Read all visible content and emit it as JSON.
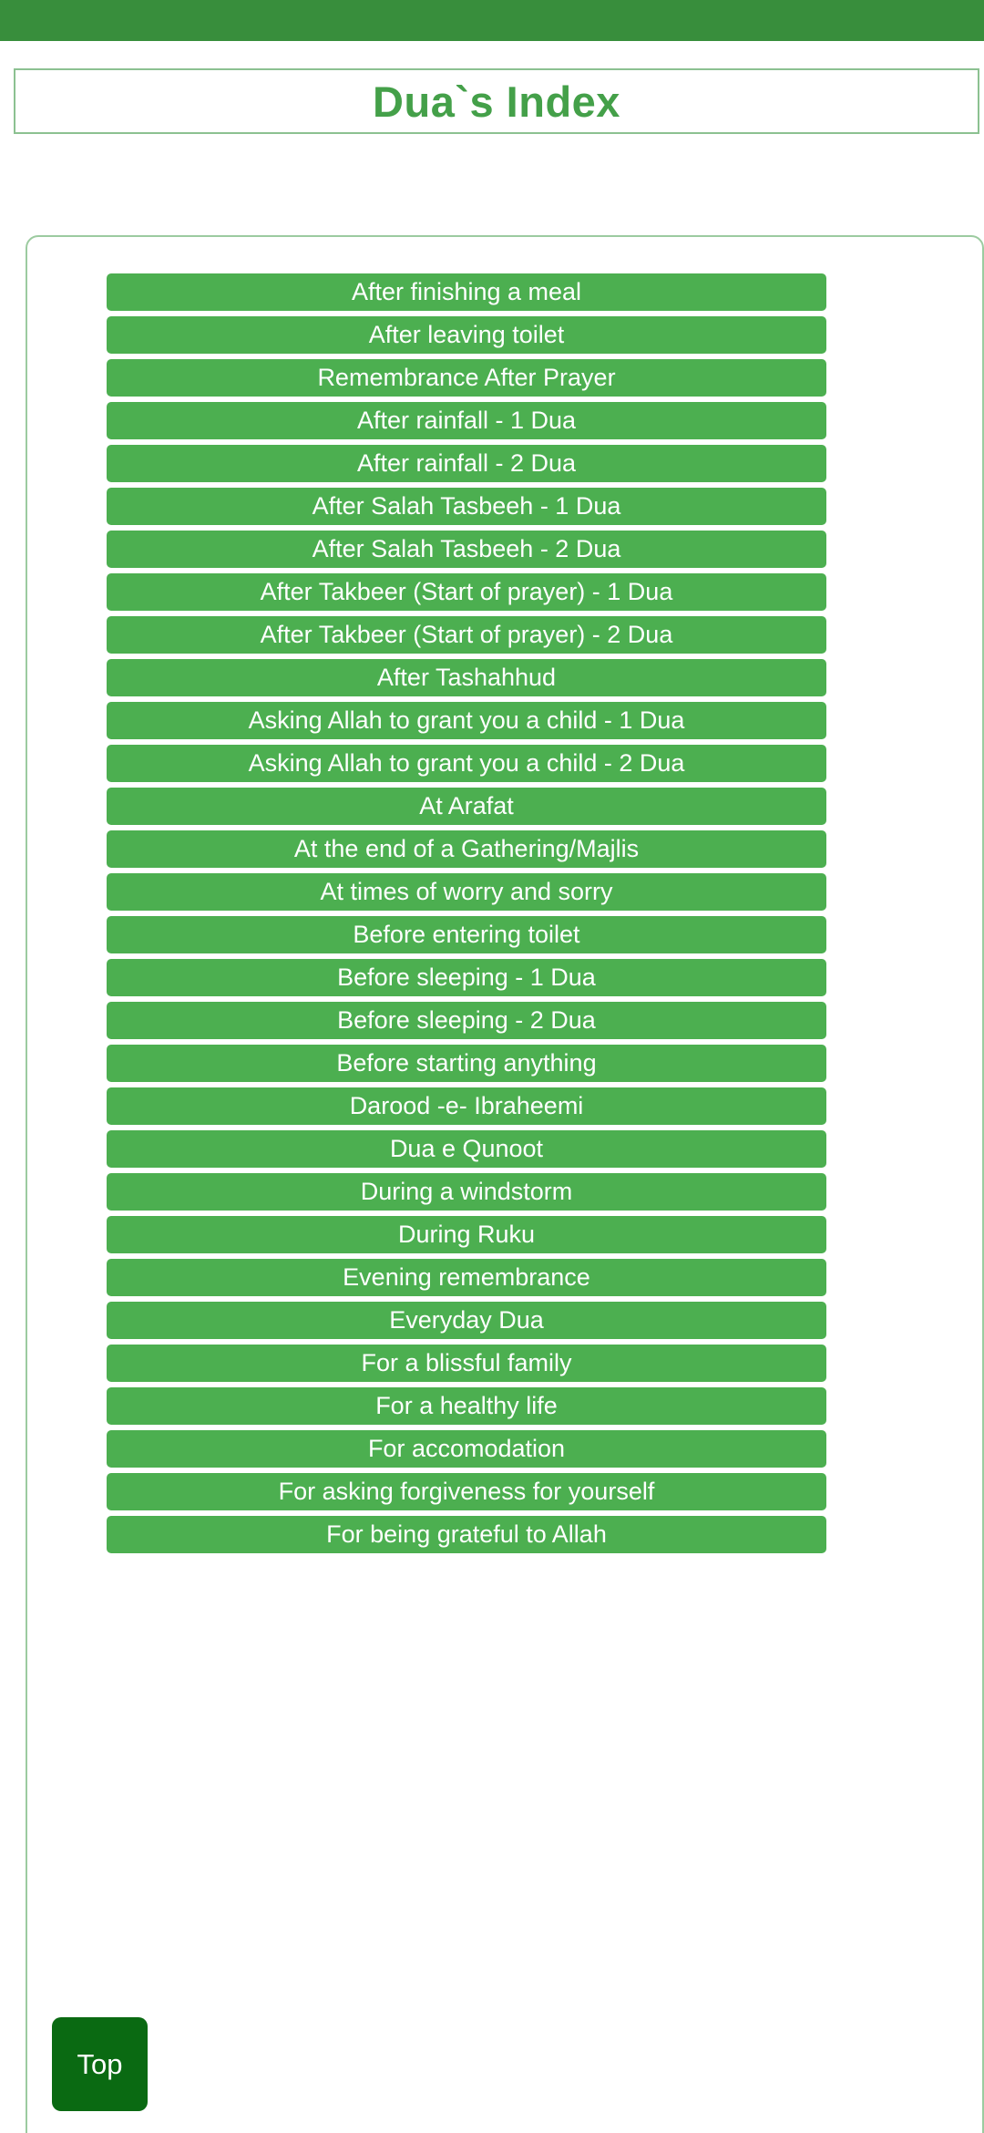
{
  "app": {
    "topbar_color": "#388e3c",
    "accent_color": "#4caf50",
    "title_color": "#44a049",
    "fab_color": "#0a6a12"
  },
  "header": {
    "title": "Dua`s Index"
  },
  "fab": {
    "label": "Top",
    "name": "scroll-to-top-button"
  },
  "list": {
    "items": [
      {
        "label": "After finishing a meal"
      },
      {
        "label": "After leaving toilet"
      },
      {
        "label": "Remembrance After Prayer"
      },
      {
        "label": "After rainfall - 1 Dua"
      },
      {
        "label": "After rainfall - 2 Dua"
      },
      {
        "label": "After Salah Tasbeeh - 1 Dua"
      },
      {
        "label": "After Salah Tasbeeh - 2 Dua"
      },
      {
        "label": "After Takbeer (Start of prayer) - 1 Dua"
      },
      {
        "label": "After Takbeer (Start of prayer) - 2 Dua"
      },
      {
        "label": "After Tashahhud"
      },
      {
        "label": "Asking Allah to grant you a child - 1 Dua"
      },
      {
        "label": "Asking Allah to grant you a child - 2 Dua"
      },
      {
        "label": "At Arafat"
      },
      {
        "label": "At the end of a Gathering/Majlis"
      },
      {
        "label": "At times of worry and sorry"
      },
      {
        "label": "Before entering toilet"
      },
      {
        "label": "Before sleeping - 1 Dua"
      },
      {
        "label": "Before sleeping - 2 Dua"
      },
      {
        "label": "Before starting anything"
      },
      {
        "label": "Darood -e- Ibraheemi"
      },
      {
        "label": "Dua e Qunoot"
      },
      {
        "label": "During a windstorm"
      },
      {
        "label": "During Ruku"
      },
      {
        "label": "Evening remembrance"
      },
      {
        "label": "Everyday Dua"
      },
      {
        "label": "For a blissful family"
      },
      {
        "label": "For a healthy life"
      },
      {
        "label": "For accomodation"
      },
      {
        "label": "For asking forgiveness for yourself"
      },
      {
        "label": "For being grateful to Allah"
      }
    ]
  }
}
